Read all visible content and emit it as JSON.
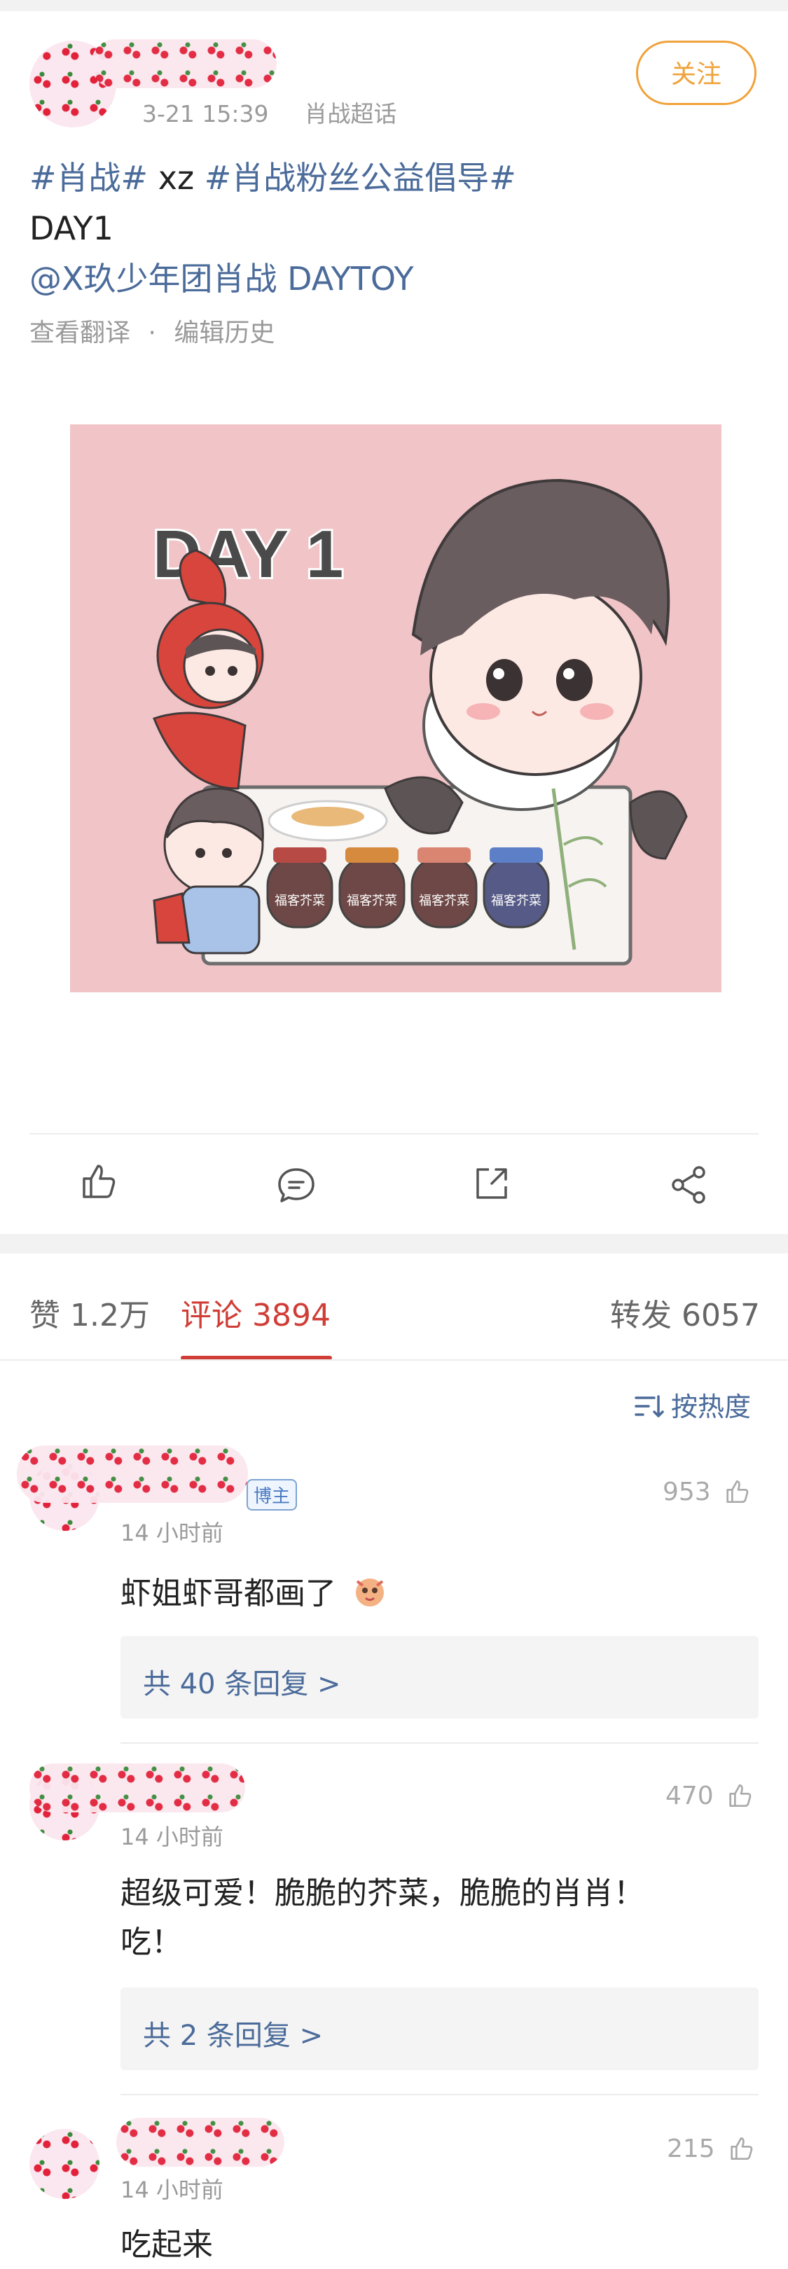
{
  "post": {
    "meta_time": "3-21 15:39",
    "meta_source": "肖战超话",
    "follow_label": "关注",
    "line1_tag1": "#肖战#",
    "line1_mid": " xz ",
    "line1_tag2": "#肖战粉丝公益倡导#",
    "line2": "DAY1",
    "line3_mention": "@X玖少年团肖战 DAYTOY",
    "translate_label": "查看翻译",
    "separator": "·",
    "edit_history_label": "编辑历史",
    "image_title": "DAY 1",
    "jar_label": "福客芥菜"
  },
  "tabs": {
    "likes": "赞 1.2万",
    "comments": "评论 3894",
    "reposts": "转发 6057"
  },
  "sort_label": "按热度",
  "comments": [
    {
      "badge": "博主",
      "time": "14 小时前",
      "likes": "953",
      "text": "虾姐虾哥都画了",
      "reply_label": "共 40 条回复 >"
    },
    {
      "time": "14 小时前",
      "likes": "470",
      "text_line1": "超级可爱！脆脆的芥菜，脆脆的肖肖！",
      "text_line2": "吃！",
      "reply_label": "共 2 条回复 >"
    },
    {
      "time": "14 小时前",
      "likes": "215",
      "text": "吃起来"
    }
  ],
  "colors": {
    "accent_orange": "#f0a23b",
    "link_blue": "#4b6b9a",
    "active_red": "#d03d36"
  }
}
